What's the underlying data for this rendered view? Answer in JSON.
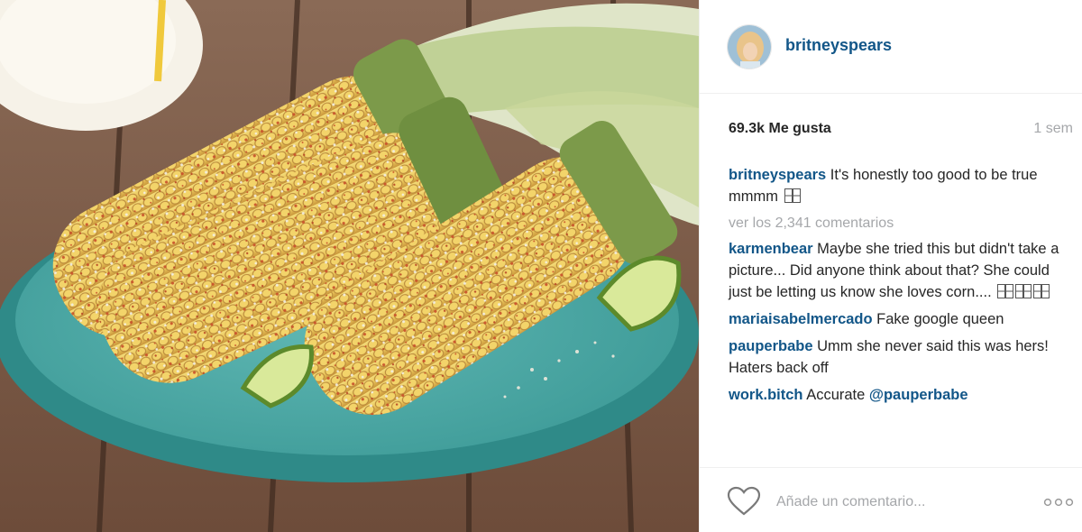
{
  "post": {
    "image_description": "",
    "username": "britneyspears",
    "likes": "69.3k Me gusta",
    "time": "1 sem"
  },
  "caption": {
    "username": "britneyspears",
    "text": " It's honestly too good to be true mmmm"
  },
  "view_comments": "ver los 2,341 comentarios",
  "comments": [
    {
      "username": "karmenbear",
      "text": " Maybe she tried this but didn't take a picture... Did anyone think about that? She could just be letting us know she loves corn...."
    },
    {
      "username": "mariaisabelmercado",
      "text": " Fake google queen"
    },
    {
      "username": "pauperbabe",
      "text": " Umm she never said this was hers! Haters back off"
    },
    {
      "username": "work.bitch",
      "text": " Accurate ",
      "mention": "@pauperbabe"
    }
  ],
  "footer": {
    "comment_placeholder": "Añade un comentario..."
  },
  "icons": {
    "like": "heart-icon",
    "options": "more-options-icon"
  },
  "colors": {
    "username": "#125688",
    "muted": "#a5a7aa",
    "text": "#262626"
  }
}
